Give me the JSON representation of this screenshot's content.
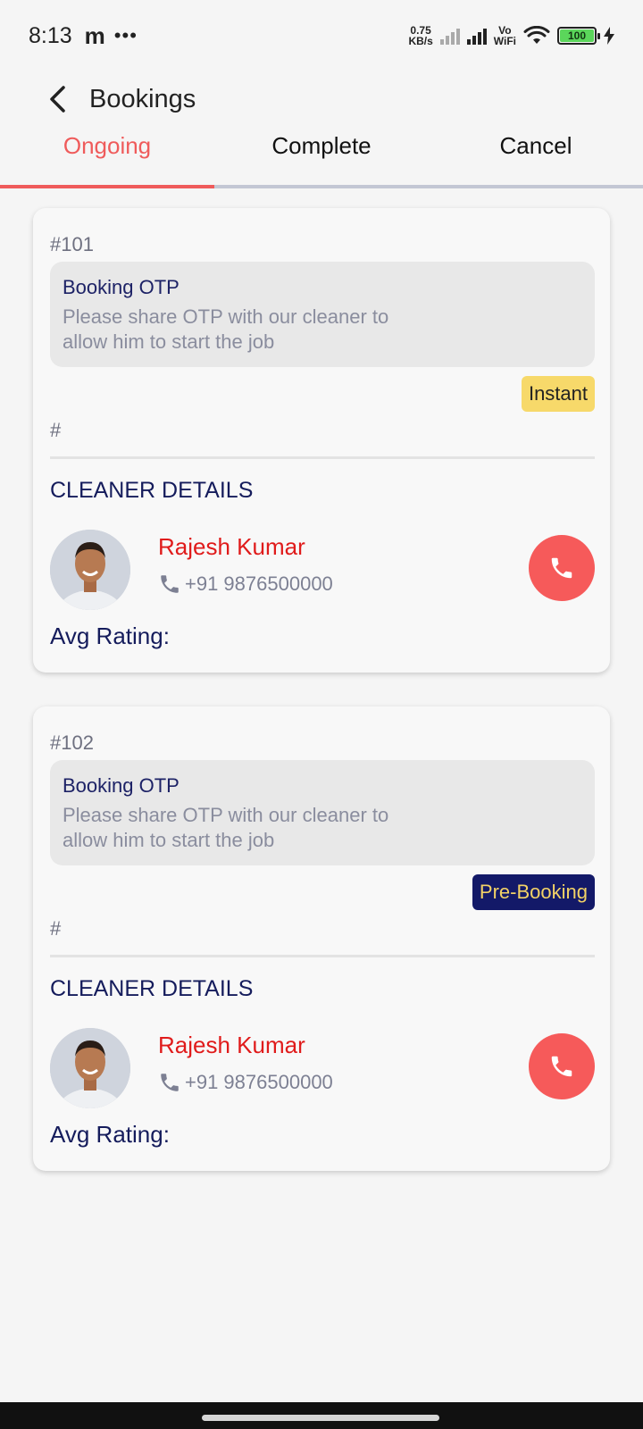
{
  "status_bar": {
    "time": "8:13",
    "carrier_icon": "m",
    "overflow": "•••",
    "net_speed_value": "0.75",
    "net_speed_unit": "KB/s",
    "vo_label_1": "Vo",
    "vo_label_2": "WiFi",
    "battery_level": "100"
  },
  "app_bar": {
    "title": "Bookings",
    "back_icon": "back-arrow-icon"
  },
  "tabs": [
    {
      "label": "Ongoing",
      "active": true
    },
    {
      "label": "Complete",
      "active": false
    },
    {
      "label": "Cancel",
      "active": false
    }
  ],
  "colors": {
    "accent": "#ef5b5b",
    "navy": "#151c5c",
    "instant_badge": "#f7d96a",
    "prebooking_badge": "#131968",
    "call_button": "#f65a5a"
  },
  "bookings": [
    {
      "id": "#101",
      "otp_title": "Booking OTP",
      "otp_desc": "Please share OTP with our cleaner to allow him to start the job",
      "badge": "Instant",
      "hash": "#",
      "section_title": "CLEANER DETAILS",
      "cleaner_name": "Rajesh Kumar",
      "phone": "+91 9876500000",
      "rating_label": "Avg Rating:"
    },
    {
      "id": "#102",
      "otp_title": "Booking OTP",
      "otp_desc": "Please share OTP with our cleaner to allow him to start the job",
      "badge": "Pre-Booking",
      "hash": "#",
      "section_title": "CLEANER DETAILS",
      "cleaner_name": "Rajesh Kumar",
      "phone": "+91 9876500000",
      "rating_label": "Avg Rating:"
    }
  ]
}
